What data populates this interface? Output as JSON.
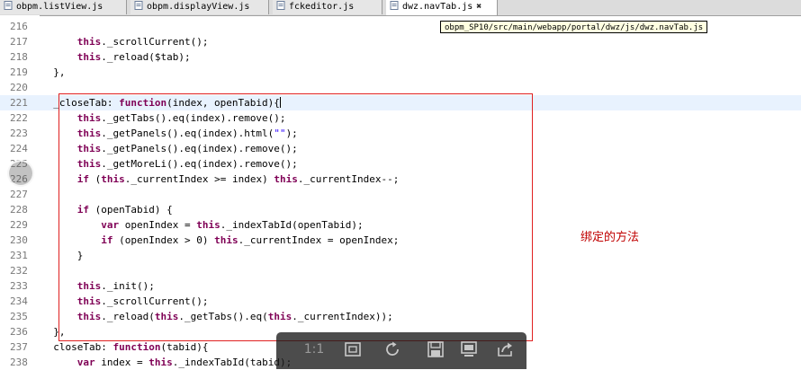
{
  "tabs": [
    {
      "label": "obpm.listView.js",
      "active": false
    },
    {
      "label": "obpm.displayView.js",
      "active": false
    },
    {
      "label": "fckeditor.js",
      "active": false
    },
    {
      "label": "dwz.navTab.js",
      "active": true
    }
  ],
  "tab_close_glyph": "✖",
  "tooltip": "obpm_SP10/src/main/webapp/portal/dwz/js/dwz.navTab.js",
  "annotation": "绑定的方法",
  "viewer": {
    "ratio_label": "1:1"
  },
  "colors": {
    "keyword": "#7f0055",
    "string": "#2a00ff",
    "annotation": "#c00000",
    "highlight_box": "#e02020"
  },
  "lines": [
    {
      "num": "216",
      "code": []
    },
    {
      "num": "217",
      "code": [
        [
          "      ",
          ""
        ],
        [
          "this",
          "kw"
        ],
        [
          "._scrollCurrent();",
          ""
        ]
      ]
    },
    {
      "num": "218",
      "code": [
        [
          "      ",
          ""
        ],
        [
          "this",
          "kw"
        ],
        [
          "._reload($tab);",
          ""
        ]
      ]
    },
    {
      "num": "219",
      "code": [
        [
          "  },",
          ""
        ]
      ]
    },
    {
      "num": "220",
      "code": []
    },
    {
      "num": "221",
      "code": [
        [
          "  _closeTab: ",
          ""
        ],
        [
          "function",
          "kw"
        ],
        [
          "(index, openTabid){",
          ""
        ]
      ],
      "current": true
    },
    {
      "num": "222",
      "code": [
        [
          "      ",
          ""
        ],
        [
          "this",
          "kw"
        ],
        [
          "._getTabs().eq(index).remove();",
          ""
        ]
      ]
    },
    {
      "num": "223",
      "code": [
        [
          "      ",
          ""
        ],
        [
          "this",
          "kw"
        ],
        [
          "._getPanels().eq(index).html(",
          ""
        ],
        [
          "\"\"",
          "str"
        ],
        [
          ");",
          ""
        ]
      ]
    },
    {
      "num": "224",
      "code": [
        [
          "      ",
          ""
        ],
        [
          "this",
          "kw"
        ],
        [
          "._getPanels().eq(index).remove();",
          ""
        ]
      ]
    },
    {
      "num": "225",
      "code": [
        [
          "      ",
          ""
        ],
        [
          "this",
          "kw"
        ],
        [
          "._getMoreLi().eq(index).remove();",
          ""
        ]
      ]
    },
    {
      "num": "226",
      "code": [
        [
          "      ",
          ""
        ],
        [
          "if",
          "kw"
        ],
        [
          " (",
          ""
        ],
        [
          "this",
          "kw"
        ],
        [
          "._currentIndex >= index) ",
          ""
        ],
        [
          "this",
          "kw"
        ],
        [
          "._currentIndex--;",
          ""
        ]
      ]
    },
    {
      "num": "227",
      "code": []
    },
    {
      "num": "228",
      "code": [
        [
          "      ",
          ""
        ],
        [
          "if",
          "kw"
        ],
        [
          " (openTabid) {",
          ""
        ]
      ]
    },
    {
      "num": "229",
      "code": [
        [
          "          ",
          ""
        ],
        [
          "var",
          "kw"
        ],
        [
          " openIndex = ",
          ""
        ],
        [
          "this",
          "kw"
        ],
        [
          "._indexTabId(openTabid);",
          ""
        ]
      ]
    },
    {
      "num": "230",
      "code": [
        [
          "          ",
          ""
        ],
        [
          "if",
          "kw"
        ],
        [
          " (openIndex > 0) ",
          ""
        ],
        [
          "this",
          "kw"
        ],
        [
          "._currentIndex = openIndex;",
          ""
        ]
      ]
    },
    {
      "num": "231",
      "code": [
        [
          "      }",
          ""
        ]
      ]
    },
    {
      "num": "232",
      "code": []
    },
    {
      "num": "233",
      "code": [
        [
          "      ",
          ""
        ],
        [
          "this",
          "kw"
        ],
        [
          "._init();",
          ""
        ]
      ]
    },
    {
      "num": "234",
      "code": [
        [
          "      ",
          ""
        ],
        [
          "this",
          "kw"
        ],
        [
          "._scrollCurrent();",
          ""
        ]
      ]
    },
    {
      "num": "235",
      "code": [
        [
          "      ",
          ""
        ],
        [
          "this",
          "kw"
        ],
        [
          "._reload(",
          ""
        ],
        [
          "this",
          "kw"
        ],
        [
          "._getTabs().eq(",
          ""
        ],
        [
          "this",
          "kw"
        ],
        [
          "._currentIndex));",
          ""
        ]
      ]
    },
    {
      "num": "236",
      "code": [
        [
          "  },",
          ""
        ]
      ]
    },
    {
      "num": "237",
      "code": [
        [
          "  closeTab: ",
          ""
        ],
        [
          "function",
          "kw"
        ],
        [
          "(tabid){",
          ""
        ]
      ]
    },
    {
      "num": "238",
      "code": [
        [
          "      ",
          ""
        ],
        [
          "var",
          "kw"
        ],
        [
          " index = ",
          ""
        ],
        [
          "this",
          "kw"
        ],
        [
          "._indexTabId(tabid);",
          ""
        ]
      ]
    }
  ]
}
